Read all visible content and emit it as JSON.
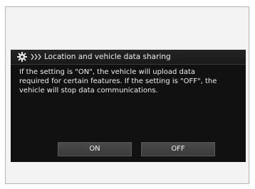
{
  "dialog": {
    "title": "Location and vehicle data sharing",
    "body_lines": [
      "If the setting is \"ON\", the vehicle will upload data",
      "required for certain features. If the setting is \"OFF\", the",
      "vehicle will stop data communications."
    ],
    "buttons": {
      "on": "ON",
      "off": "OFF"
    }
  },
  "icons": {
    "settings": "gear-icon",
    "breadcrumb": "chevrons-icon"
  },
  "colors": {
    "screen_background": "#111111",
    "header_background": "#242424",
    "text": "#eeeeee",
    "button_background": "#454545",
    "frame_background": "#f3f3f3"
  }
}
